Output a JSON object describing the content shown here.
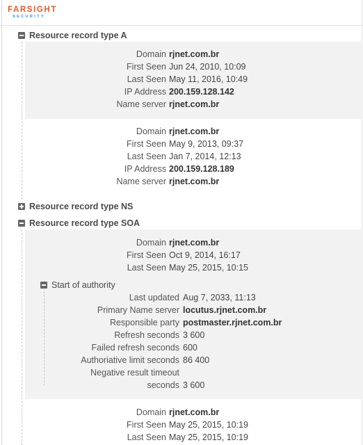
{
  "logo": {
    "main": "FARSIGHT",
    "sub": "SECURITY"
  },
  "sections": {
    "a": {
      "title": "Resource record type A",
      "expanded": true
    },
    "ns": {
      "title": "Resource record type NS",
      "expanded": false
    },
    "soa": {
      "title": "Resource record type SOA",
      "expanded": true
    }
  },
  "labels": {
    "domain": "Domain",
    "first_seen": "First Seen",
    "last_seen": "Last Seen",
    "ip_address": "IP Address",
    "name_server": "Name server"
  },
  "a_records": [
    {
      "domain": "rjnet.com.br",
      "first_seen": "Jun 24, 2010, 10:09",
      "last_seen": "May 11, 2016, 10:49",
      "ip_address": "200.159.128.142",
      "name_server": "rjnet.com.br"
    },
    {
      "domain": "rjnet.com.br",
      "first_seen": "May 9, 2013, 09:37",
      "last_seen": "Jan 7, 2014, 12:13",
      "ip_address": "200.159.128.189",
      "name_server": "rjnet.com.br"
    }
  ],
  "soa_records": [
    {
      "domain": "rjnet.com.br",
      "first_seen": "Oct 9, 2014, 16:17",
      "last_seen": "May 25, 2015, 10:15"
    },
    {
      "domain": "rjnet.com.br",
      "first_seen": "May 25, 2015, 10:19",
      "last_seen": "May 25, 2015, 10:19"
    }
  ],
  "soa_authority": {
    "title": "Start of authority",
    "labels": {
      "last_updated": "Last updated",
      "primary_ns": "Primary Name server",
      "responsible": "Responsible party",
      "refresh": "Refresh seconds",
      "failed_refresh": "Failed refresh seconds",
      "auth_limit": "Authoriative limit seconds",
      "neg_timeout_1": "Negative result timeout",
      "neg_timeout_2": "seconds"
    },
    "values": {
      "last_updated": "Aug 7, 2033, 11:13",
      "primary_ns": "locutus.rjnet.com.br",
      "responsible": "postmaster.rjnet.com.br",
      "refresh": "3 600",
      "failed_refresh": "600",
      "auth_limit": "86 400",
      "neg_timeout": "3 600"
    }
  },
  "colors": {
    "logo_orange": "#e35a2a",
    "logo_blue": "#2f8fd8",
    "record_bg": "#f2f2f2"
  }
}
